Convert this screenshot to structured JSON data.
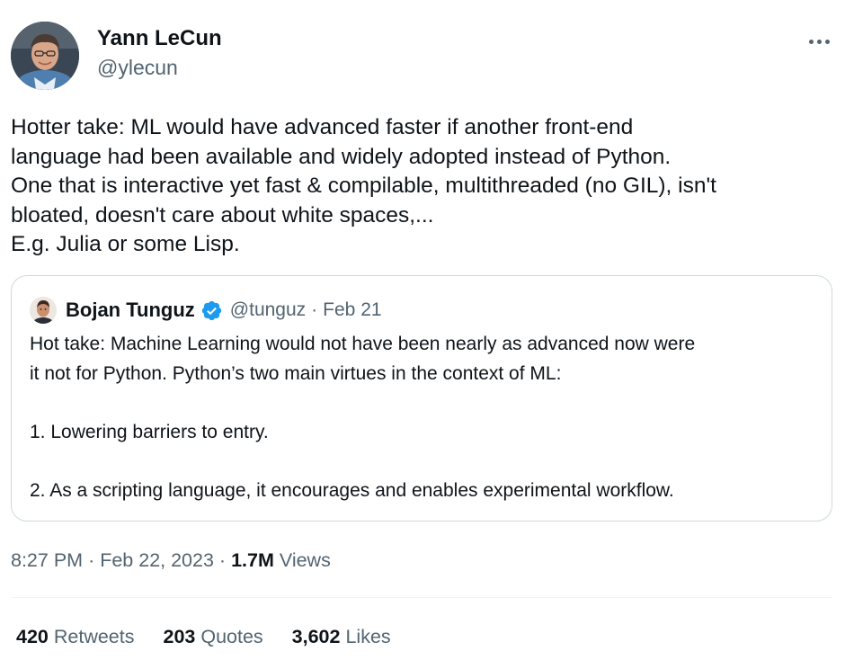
{
  "author": {
    "name": "Yann LeCun",
    "handle": "@ylecun"
  },
  "tweet": {
    "lines": [
      "Hotter take: ML would have advanced faster if another front-end",
      "language had been available and widely adopted instead of Python.",
      "One that is interactive yet fast & compilable, multithreaded (no GIL), isn't",
      "bloated, doesn't care about white spaces,...",
      "E.g. Julia or some Lisp."
    ]
  },
  "quoted": {
    "name": "Bojan Tunguz",
    "handle": "@tunguz",
    "separator": "·",
    "date": "Feb 21",
    "verified_icon": "verified-badge-icon",
    "verified_color": "#1d9bf0",
    "lines": [
      "Hot take: Machine Learning would not have been nearly as advanced now were",
      "it not for Python. Python’s two main virtues in the context of ML:",
      "",
      "1. Lowering barriers to entry.",
      "",
      "2. As a scripting language, it encourages and enables experimental workflow."
    ]
  },
  "meta": {
    "time": "8:27 PM",
    "separator1": "·",
    "date": "Feb 22, 2023",
    "separator2": "·",
    "views_count": "1.7M",
    "views_label": "Views"
  },
  "stats": {
    "retweets_count": "420",
    "retweets_label": "Retweets",
    "quotes_count": "203",
    "quotes_label": "Quotes",
    "likes_count": "3,602",
    "likes_label": "Likes"
  },
  "more_icon": "more-horizontal-icon",
  "colors": {
    "text": "#0f1419",
    "secondary": "#536471",
    "border": "#cfd9de",
    "accent": "#1d9bf0"
  }
}
